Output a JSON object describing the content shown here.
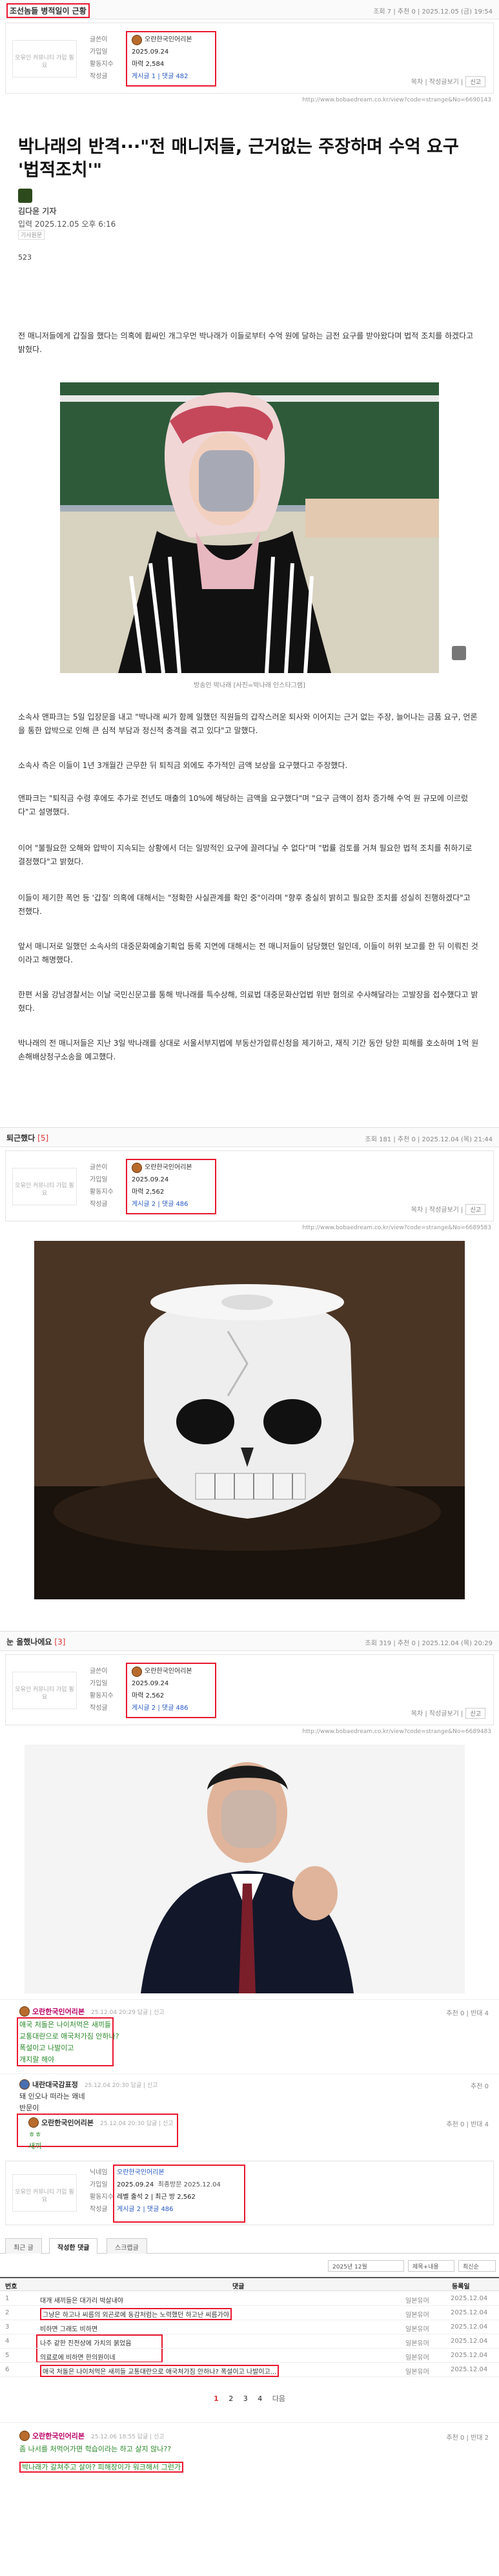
{
  "post1": {
    "title": "조선놈들 병적일이 근황",
    "meta": "조회 7 | 추천 0 | 2025.12.05 (금) 19:54",
    "logo": "오유인 커뮤니티 가입 필요",
    "labels": [
      "글쓴이",
      "가입일",
      "활동지수",
      "작성글"
    ],
    "nickname": "오란한국인어리본",
    "join": "2025.09.24",
    "activity": "마력 2,584",
    "posts": "게시글 1 | 댓글 482",
    "tools": "목차 | 작성글보기 |",
    "tool_btn": "신고",
    "url": "http://www.bobaedream.co.kr/view?code=strange&No=6690143",
    "article_title": "박나래의 반격···\"전 매니저들, 근거없는 주장하며 수억 요구 '법적조치'\"",
    "reporter": "김다윤 기자",
    "date": "입력 2025.12.05   오후 6:16",
    "source": "기사원문",
    "stats": "523",
    "p1": "전 매니저들에게 갑질을 했다는 의혹에 휩싸인 개그우먼 박나래가 이들로부터 수억 원에 달하는 금전 요구를 받아왔다며 법적 조치를 하겠다고 밝혔다.",
    "caption": "방송인 박나래 [사진=박나래 인스타그램]",
    "p2": "소속사 앤파크는 5일 입장문을 내고 \"박나래 씨가 함께 일했던 직원들의 갑작스러운 퇴사와 이어지는 근거 없는 주장, 늘어나는 금품 요구, 언론을 통한 압박으로 인해 큰 심적 부담과 정신적 충격을 겪고 있다\"고 말했다.",
    "p3": "소속사 측은 이들이 1년 3개월간 근무한 뒤 퇴직금 외에도 추가적인 금액 보상을 요구했다고 주장했다.",
    "p4": "앤파크는 \"퇴직금 수령 후에도 추가로 전년도 매출의 10%에 해당하는 금액을 요구했다\"며 \"요구 금액이 점차 증가해 수억 원 규모에 이르렀다\"고 설명했다.",
    "p5": "이어 \"불필요한 오해와 압박이 지속되는 상황에서 더는 일방적인 요구에 끌려다닐 수 없다\"며 \"법률 검토를 거쳐 필요한 법적 조치를 취하기로 결정했다\"고 밝혔다.",
    "p6": "이들이 제기한 폭언 등 '갑질' 의혹에 대해서는 \"정확한 사실관계를 확인 중\"이라며 \"향후 충실히 밝히고 필요한 조치를 성실히 진행하겠다\"고 전했다.",
    "p7": "앞서 매니저로 일했던 소속사의 대중문화예술기획업 등록 지연에 대해서는 전 매니저들이 담당했던 일인데, 이들이 허위 보고를 한 뒤 이뤄진 것이라고 해명했다.",
    "p8": "한편 서울 강남경찰서는 이날 국민신문고를 통해 박나래를 특수상해, 의료법 대중문화산업법 위반 혐의로 수사해달라는 고발장을 접수했다고 밝혔다.",
    "p9": "박나래의 전 매니저들은 지난 3일 박나래를 상대로 서울서부지법에 부동산가압류신청을 제기하고, 재직 기간 동안 당한 피해를 호소하며 1억 원 손해배상청구소송을 예고했다."
  },
  "post2": {
    "title": "퇴근했다",
    "count": "[5]",
    "meta": "조회 181 | 추천 0 | 2025.12.04 (목) 21:44",
    "logo": "오유인 커뮤니티 가입 필요",
    "labels": [
      "글쓴이",
      "가입일",
      "활동지수",
      "작성글"
    ],
    "nickname": "오란한국인어리본",
    "join": "2025.09.24",
    "activity": "마력 2,562",
    "posts": "게시글 2 | 댓글 486",
    "tools": "목차 | 작성글보기 |",
    "tool_btn": "신고",
    "url": "http://www.bobaedream.co.kr/view?code=strange&No=6689583"
  },
  "post3": {
    "title": "눈 올했나에요",
    "count": "[3]",
    "meta": "조회 319 | 추천 0 | 2025.12.04 (목) 20:29",
    "logo": "오유인 커뮤니티 가입 필요",
    "labels": [
      "글쓴이",
      "가입일",
      "활동지수",
      "작성글"
    ],
    "nickname": "오란한국인어리본",
    "join": "2025.09.24",
    "activity": "마력 2,562",
    "posts": "게시글 2 | 댓글 486",
    "tools": "목차 | 작성글보기 |",
    "tool_btn": "신고",
    "url": "http://www.bobaedream.co.kr/view?code=strange&No=6689483"
  },
  "comments": [
    {
      "user": "오란한국인어리본",
      "date": "25.12.04 20:29 답글 | 신고",
      "lines": [
        "애국 처돌은 나이처먹은 새끼들",
        "교통대란으로 애국처가짐 안하나?",
        "폭설이고 나발이고",
        "개지랄 해야"
      ],
      "count": "추천 0 | 반대 4"
    },
    {
      "user": "내란대국감표정",
      "date": "25.12.04 20:30 답글 | 신고",
      "lines": [
        "돼 인오나 떠라는 왜네",
        "반문이"
      ],
      "count": "추천 0"
    },
    {
      "user": "오란한국인어리본",
      "date": "25.12.04 20:30 답글 | 신고",
      "lines": [
        "ㅎㅎ",
        "새끼"
      ],
      "count": "추천 0 | 반대 4"
    }
  ],
  "profile": {
    "logo": "오유인 커뮤니티 가입 필요",
    "labels": [
      "닉네임",
      "가입일",
      "활동지수",
      "작성글"
    ],
    "nickname": "오란한국인어리본",
    "join": "2025.09.24",
    "last": "최종방문 2025.12.04",
    "activity": "레벨 출석 2 | 최근 방 2,562",
    "posts": "게시글 2 | 댓글 486"
  },
  "tabs": [
    "최근 글",
    "작성한 댓글",
    "스크랩글"
  ],
  "filters": {
    "year": "2025년 12월",
    "sort": "제목+내용",
    "order": "최신순"
  },
  "table": {
    "headers": [
      "번호",
      "댓글",
      "",
      "등록일"
    ],
    "rows": [
      {
        "num": "1",
        "title": "대개 새끼들은 대가리 박살내야",
        "cat": "일본유머",
        "date": "2025.12.04"
      },
      {
        "num": "2",
        "title": "그냥은 하고나 씨름의 외곤로에 동감처럼는 노력했던 하고난 씨름가야",
        "cat": "일본유머",
        "date": "2025.12.04"
      },
      {
        "num": "3",
        "title": "비하면 그래도 비하면",
        "cat": "일본유머",
        "date": "2025.12.04"
      },
      {
        "num": "4",
        "title": "나주 같한 진전상에 가치의 붉었음",
        "cat": "일본유머",
        "date": "2025.12.04"
      },
      {
        "num": "5",
        "title": "의료로에 비하면 한의원이네",
        "cat": "일본유머",
        "date": "2025.12.04"
      },
      {
        "num": "6",
        "title": "애국 처돌은 나이처먹은 새끼들 교통대란으로 애국처가짐 안하나? 폭설이고 나발이고...",
        "cat": "일본유머",
        "date": "2025.12.04"
      }
    ]
  },
  "pager": [
    "1",
    "2",
    "3",
    "4",
    "다음"
  ],
  "last_comment": {
    "user": "오란한국인어리본",
    "date": "25.12.06 18:55 답글 | 신고",
    "lines": [
      "좀 나서를 처먹어가면 학습이라는 하고 살지 않나??",
      "박나래가 갈쳐주고 살아?  피해장이가 워크해서 그런가"
    ],
    "count": "추천 0 | 반대 2"
  }
}
